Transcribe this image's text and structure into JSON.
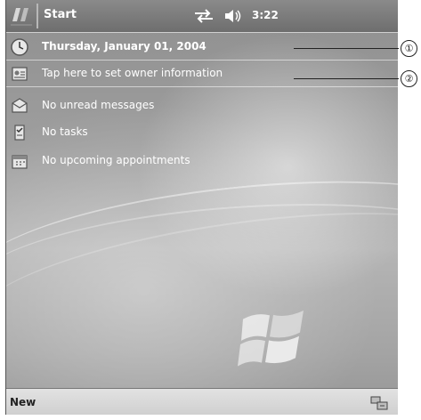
{
  "title_bar": {
    "title": "Start",
    "clock": "3:22",
    "icons": [
      "start-flag-icon",
      "connectivity-icon",
      "volume-icon"
    ]
  },
  "today_items": [
    {
      "label": "Thursday, January 01, 2004",
      "icon": "calendar-icon",
      "bold": true
    },
    {
      "label": "Tap here to set owner information",
      "icon": "owner-icon",
      "bold": false
    },
    {
      "label": "No unread messages",
      "icon": "messages-icon",
      "bold": false
    },
    {
      "label": "No tasks",
      "icon": "tasks-icon",
      "bold": false
    },
    {
      "label": "No upcoming appointments",
      "icon": "appointments-icon",
      "bold": false
    }
  ],
  "command_bar": {
    "new_label": "New",
    "input_icon": "input-panel-icon"
  },
  "callouts": [
    "①",
    "②"
  ],
  "colors": {
    "title_bar": "#6e6e6e",
    "text": "#ffffff",
    "command_bar": "#d8d8d8"
  }
}
